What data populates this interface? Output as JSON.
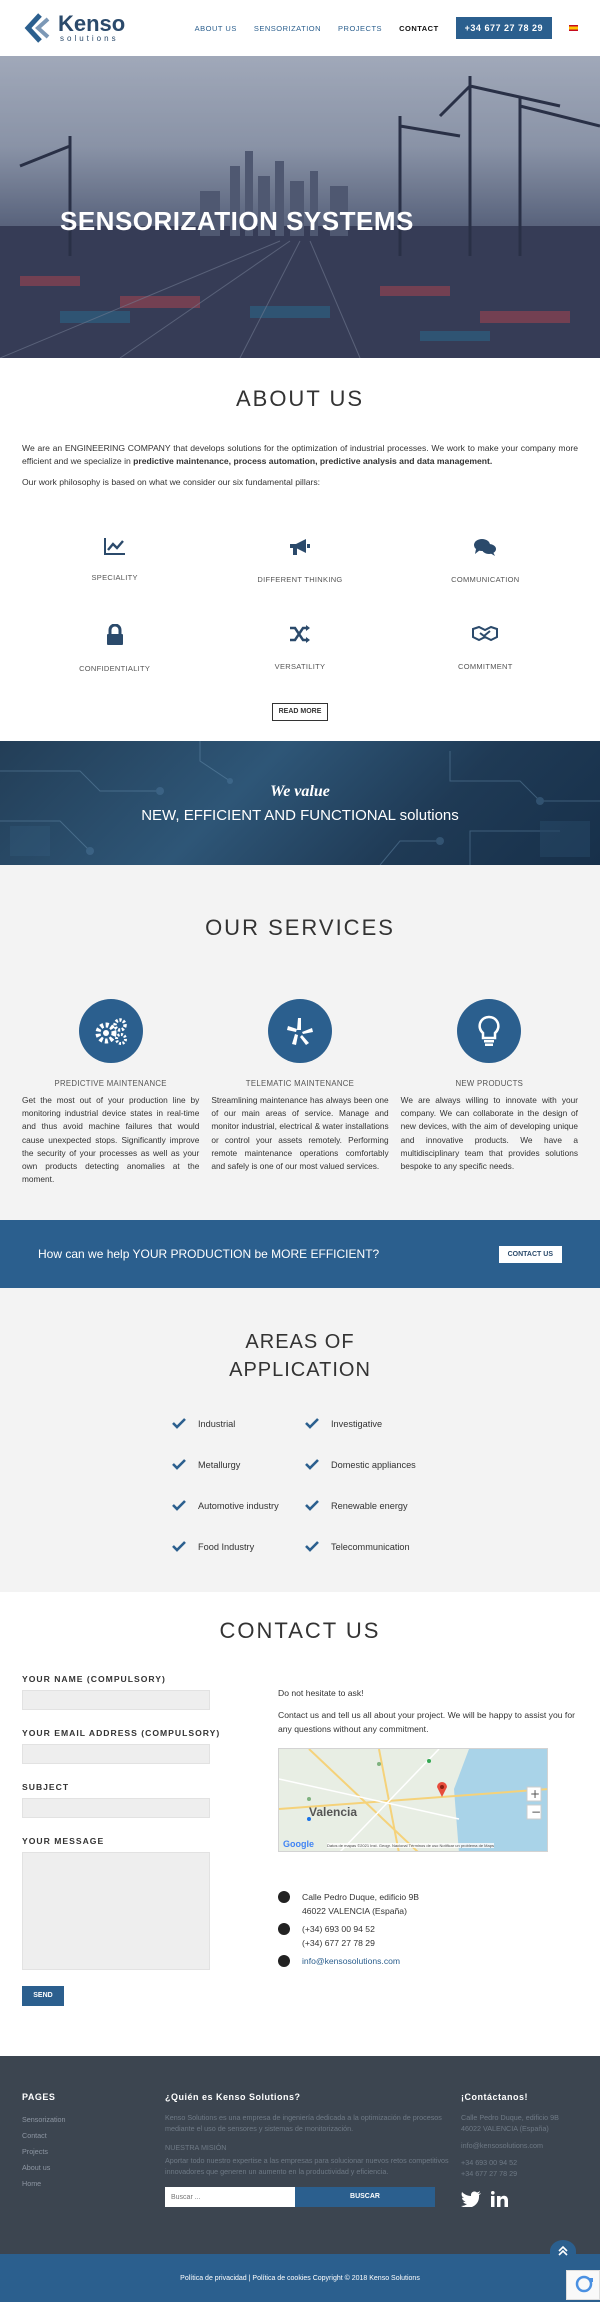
{
  "nav": {
    "logo_name": "Kenso",
    "logo_sub": "solutions",
    "items": [
      {
        "label": "ABOUT US"
      },
      {
        "label": "SENSORIZATION"
      },
      {
        "label": "PROJECTS"
      },
      {
        "label": "CONTACT"
      }
    ],
    "phone": "+34 677 27 78 29"
  },
  "hero": {
    "title": "SENSORIZATION SYSTEMS"
  },
  "about": {
    "title": "ABOUT US",
    "para1_start": "We are an ENGINEERING COMPANY that develops solutions for the optimization of industrial processes. We work to make your company more efficient and we specialize in ",
    "para1_bold": "predictive maintenance, process automation, predictive analysis and data management.",
    "para2": "Our work philosophy is based on what we consider our six fundamental pillars:",
    "pillars": [
      {
        "label": "SPECIALITY",
        "icon": "chart-line-icon"
      },
      {
        "label": "DIFFERENT THINKING",
        "icon": "bullhorn-icon"
      },
      {
        "label": "COMMUNICATION",
        "icon": "comments-icon"
      },
      {
        "label": "CONFIDENTIALITY",
        "icon": "lock-icon"
      },
      {
        "label": "VERSATILITY",
        "icon": "shuffle-icon"
      },
      {
        "label": "COMMITMENT",
        "icon": "handshake-icon"
      }
    ],
    "read_more": "READ MORE"
  },
  "value": {
    "line1": "We value",
    "line2": "NEW, EFFICIENT AND FUNCTIONAL solutions"
  },
  "services": {
    "title": "OUR SERVICES",
    "items": [
      {
        "title": "PREDICTIVE MAINTENANCE",
        "text": "Get the most out of your production line by monitoring industrial device states in real-time and thus avoid machine failures that would cause unexpected stops. Significantly improve the security of your processes as well as your own products detecting anomalies at the moment.",
        "icon": "gears-icon"
      },
      {
        "title": "TELEMATIC MAINTENANCE",
        "text": "Streamlining maintenance has always been one of our main areas of service. Manage and monitor industrial, electrical & water installations or control your assets remotely. Performing remote maintenance operations comfortably and safely is one of our most valued services.",
        "icon": "yelp-like-icon"
      },
      {
        "title": "NEW PRODUCTS",
        "text": "We are always willing to innovate with your company. We can collaborate in the design of new devices, with the aim of developing unique and innovative products. We have a multidisciplinary team that provides solutions bespoke to any specific needs.",
        "icon": "lightbulb-icon"
      }
    ]
  },
  "cta": {
    "text": "How can we help YOUR PRODUCTION be MORE EFFICIENT?",
    "button": "CONTACT US"
  },
  "areas": {
    "title_line1": "AREAS OF",
    "title_line2": "APPLICATION",
    "items": [
      "Industrial",
      "Investigative",
      "Metallurgy",
      "Domestic appliances",
      "Automotive industry",
      "Renewable energy",
      "Food Industry",
      "Telecommunication"
    ]
  },
  "contact": {
    "title": "CONTACT US",
    "name_label": "YOUR NAME (COMPULSORY)",
    "email_label": "YOUR EMAIL ADDRESS (COMPULSORY)",
    "subject_label": "SUBJECT",
    "message_label": "YOUR MESSAGE",
    "send": "SEND",
    "intro1": "Do not hesitate to ask!",
    "intro2": "Contact us and tell us all about your project. We will be happy to assist you for any questions without any commitment.",
    "map": {
      "city": "Valencia",
      "brand": "Google",
      "attribution": "Datos de mapas ©2021 Inst. Geogr. Nacional   Términos de uso   Notificar un problema de Maps"
    },
    "address1": "Calle Pedro Duque, edificio 9B",
    "address2": "46022 VALENCIA (España)",
    "phone1": "(+34) 693 00 94 52",
    "phone2": "(+34) 677 27 78 29",
    "email": "info@kensosolutions.com"
  },
  "footer": {
    "pages_title": "PAGES",
    "pages": [
      "Sensorization",
      "Contact",
      "Projects",
      "About us",
      "Home"
    ],
    "who_title": "¿Quién es Kenso Solutions?",
    "who_text": "Kenso Solutions es una empresa de ingeniería dedicada a la optimización de procesos mediante el uso de sensores y sistemas de monitorización.",
    "mission_title": "NUESTRA MISIÓN",
    "mission_text": "Aportar todo nuestro expertise a las empresas para solucionar nuevos retos competitivos innovadores que generen un aumento en la productividad y eficiencia.",
    "search_placeholder": "Buscar ...",
    "search_button": "BUSCAR",
    "contact_title": "¡Contáctanos!",
    "contact_lines": [
      "Calle Pedro Duque, edificio 9B",
      "46022 VALENCIA (España)",
      "info@kensosolutions.com",
      "+34 693 00 94 52",
      "+34 677 27 78 29"
    ],
    "social": [
      "twitter-icon",
      "linkedin-icon"
    ]
  },
  "bottom": {
    "text": "Política de privacidad | Política de cookies Copyright © 2018 Kenso Solutions"
  },
  "colors": {
    "brand": "#2b5f8e",
    "dark": "#2b4a6b",
    "footer": "#3c4550"
  }
}
